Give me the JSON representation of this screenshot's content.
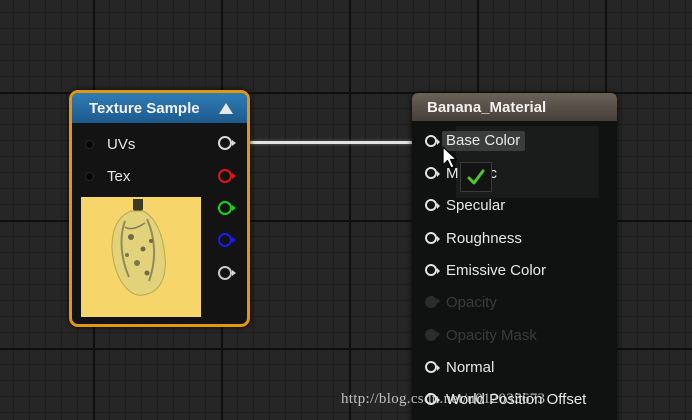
{
  "texture_node": {
    "title": "Texture Sample",
    "inputs": [
      {
        "label": "UVs"
      },
      {
        "label": "Tex"
      }
    ],
    "outputs": [
      {
        "channel": "RGB",
        "color": "#d8d8d8"
      },
      {
        "channel": "R",
        "color": "#e01616"
      },
      {
        "channel": "G",
        "color": "#1fcf1f"
      },
      {
        "channel": "B",
        "color": "#1c1ce6"
      },
      {
        "channel": "A",
        "color": "#c8c8c8"
      }
    ],
    "border_color": "#e5960c",
    "header_color": "#2f7cb6"
  },
  "material_node": {
    "title": "Banana_Material",
    "pins": [
      {
        "label": "Base Color",
        "enabled": true
      },
      {
        "label": "Metallic",
        "enabled": true
      },
      {
        "label": "Specular",
        "enabled": true
      },
      {
        "label": "Roughness",
        "enabled": true
      },
      {
        "label": "Emissive Color",
        "enabled": true
      },
      {
        "label": "Opacity",
        "enabled": false
      },
      {
        "label": "Opacity Mask",
        "enabled": false
      },
      {
        "label": "Normal",
        "enabled": true
      },
      {
        "label": "World Position Offset",
        "enabled": true
      }
    ],
    "metallic_visible_parts": [
      "M",
      "c"
    ]
  },
  "drag_feedback": {
    "icon": "checkmark-icon",
    "color": "#4fc72a"
  },
  "watermark": "http://blog.csdn.net/u012035673"
}
